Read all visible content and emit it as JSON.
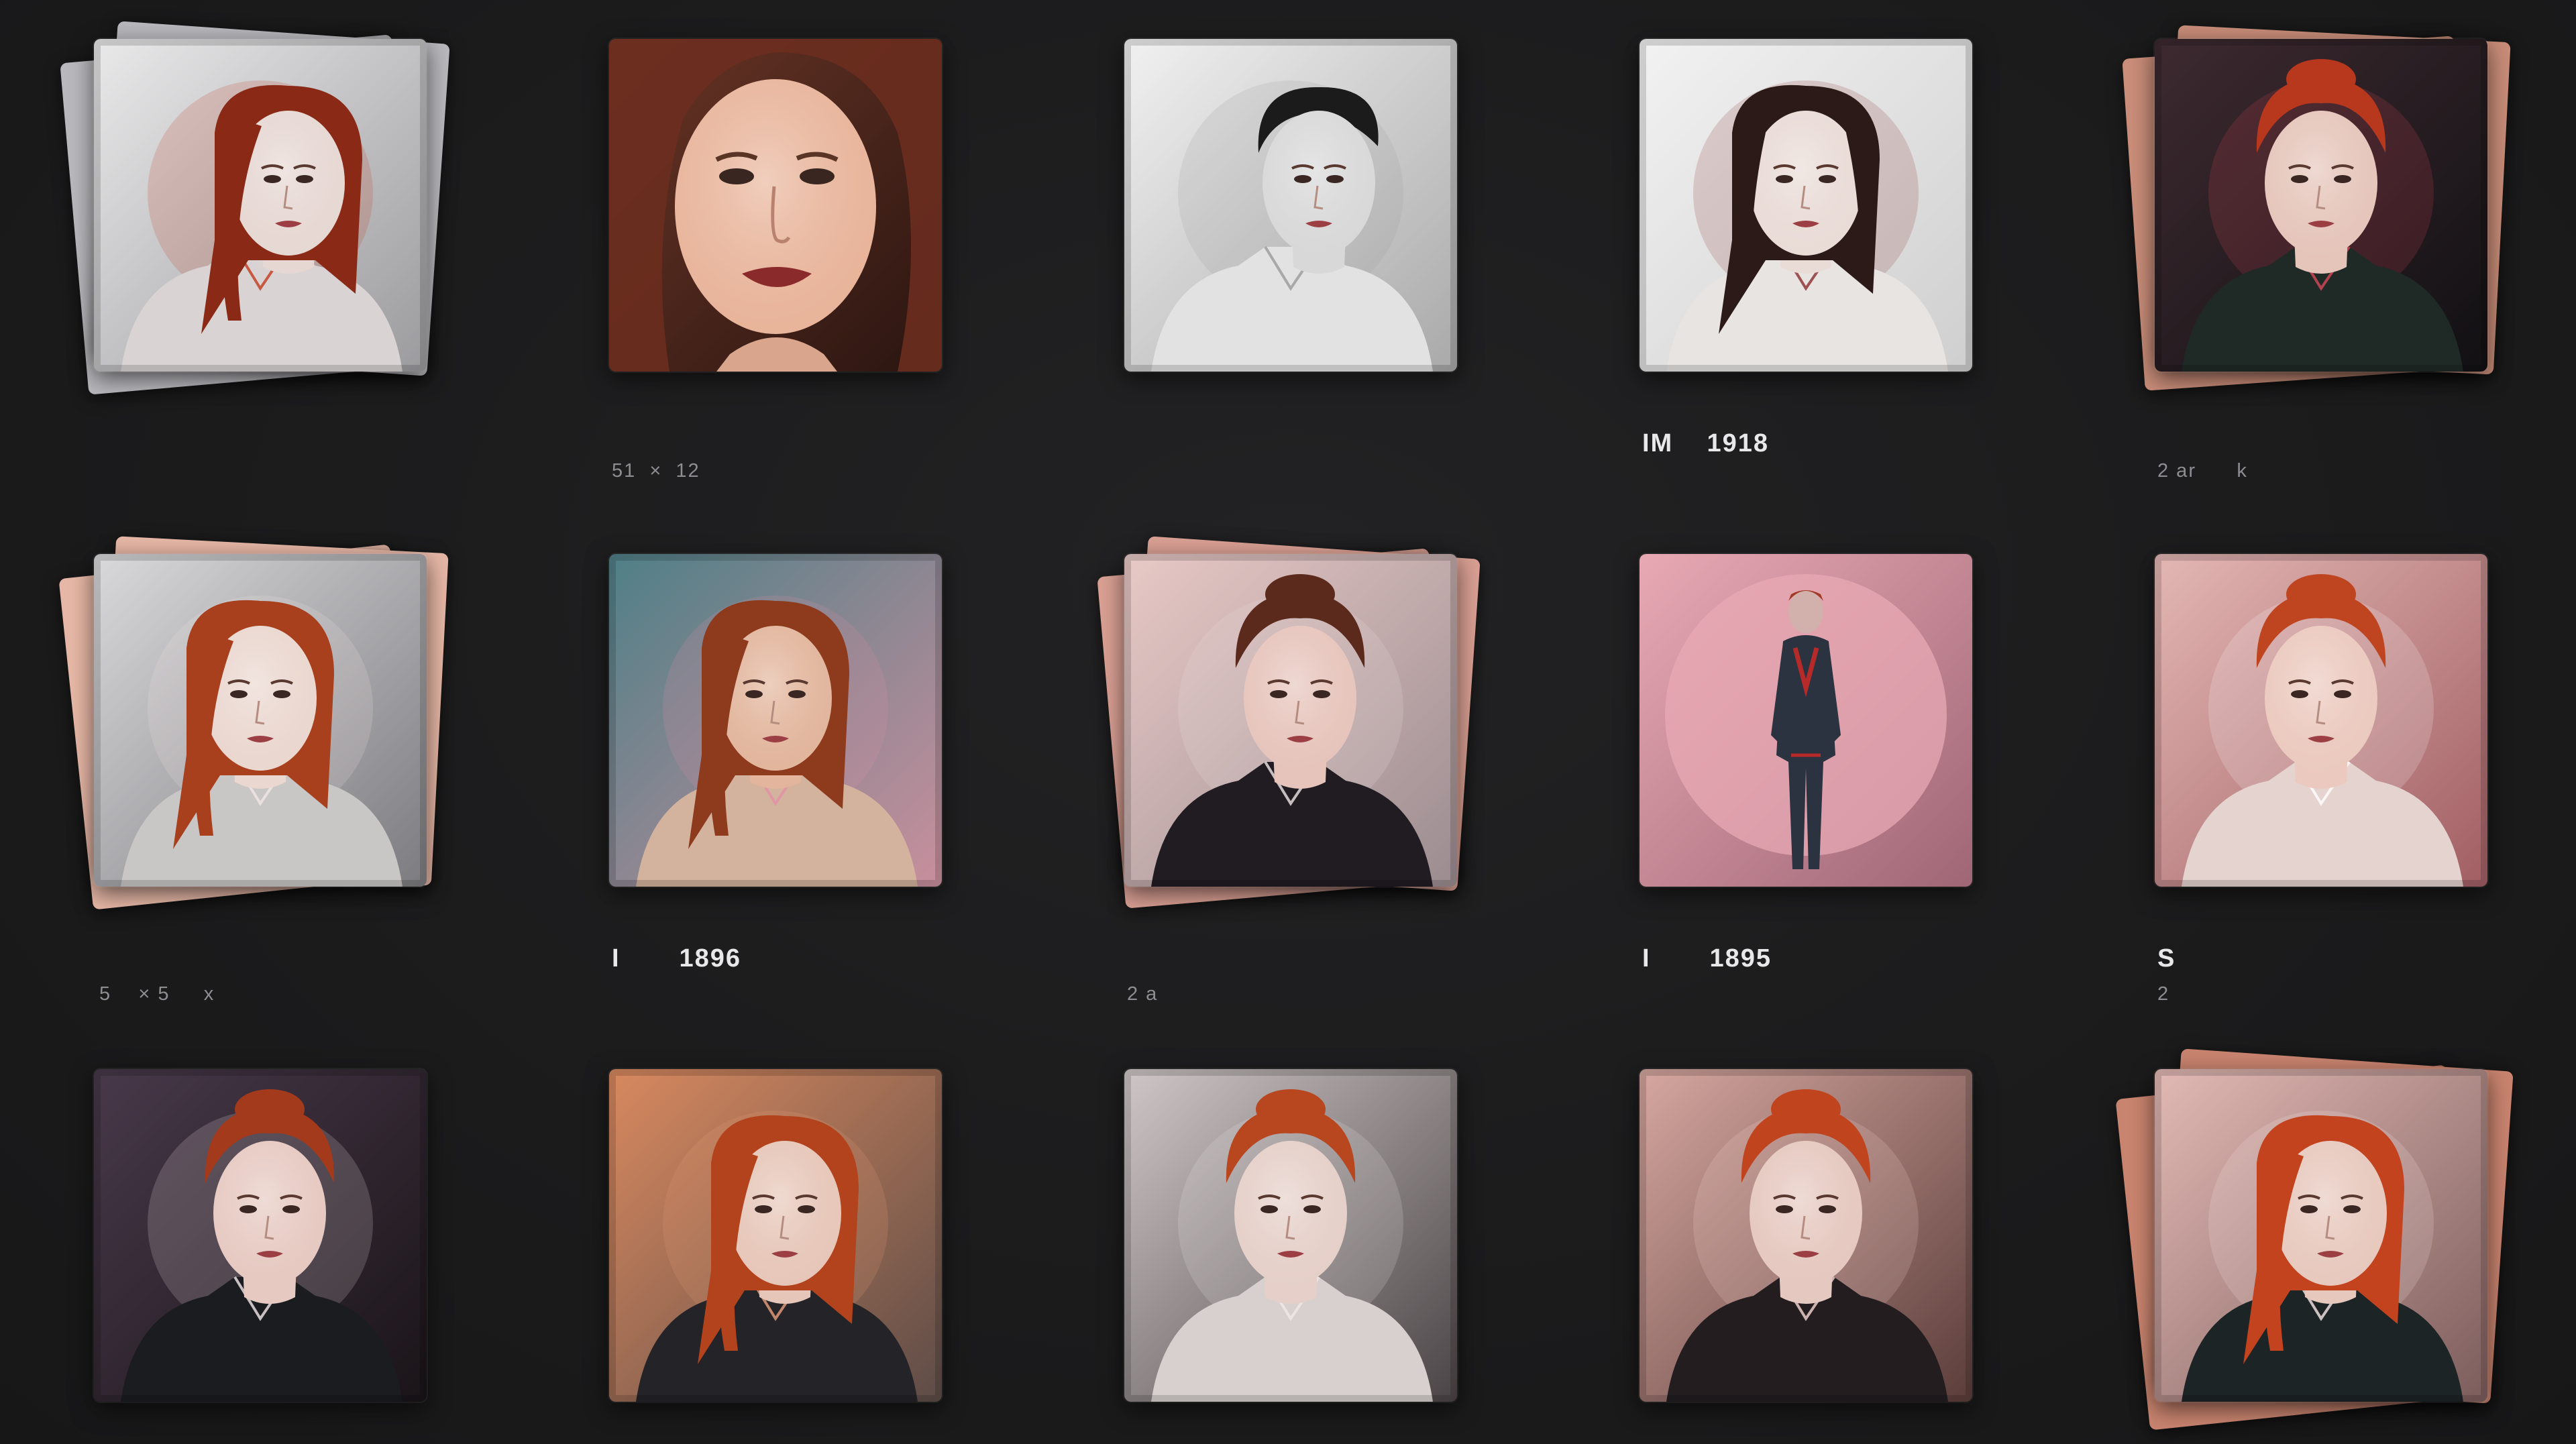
{
  "gallery": {
    "items": [
      {
        "title": "",
        "meta": "",
        "palette": {
          "bg1": "#e9e9ea",
          "bg2": "#9b9b9e",
          "skin": "#e6d7d2",
          "hair": "#8a2a16",
          "suit": "#d9d4d3",
          "accent": "#c23a1c"
        },
        "stacked": true,
        "stack_color": "#b9b9bd",
        "hair_style": "long-side",
        "pose": "profile"
      },
      {
        "title": "",
        "meta": "51  ×  12",
        "palette": {
          "bg1": "#6a3526",
          "bg2": "#2a1510",
          "skin": "#e8b49a",
          "hair": "#6c2e1f",
          "suit": "#d9a58c",
          "accent": "#8a2a2a"
        },
        "stacked": false,
        "stack_color": "",
        "hair_style": "long",
        "pose": "closeup"
      },
      {
        "title": "",
        "meta": "",
        "palette": {
          "bg1": "#f1f1f1",
          "bg2": "#a9a9a9",
          "skin": "#d8d8d8",
          "hair": "#1b1b1b",
          "suit": "#e2e2e2",
          "accent": "#9a9a9a"
        },
        "stacked": false,
        "stack_color": "",
        "hair_style": "short",
        "pose": "profile"
      },
      {
        "title": "IM    1918",
        "meta": "",
        "palette": {
          "bg1": "#f2f2f2",
          "bg2": "#cfcfcf",
          "skin": "#e9dbd6",
          "hair": "#2b1a17",
          "suit": "#e7e4e2",
          "accent": "#8b2d2d"
        },
        "stacked": false,
        "stack_color": "",
        "hair_style": "long",
        "pose": "front"
      },
      {
        "title": "",
        "meta": "2 ar      k",
        "palette": {
          "bg1": "#3d2a30",
          "bg2": "#111013",
          "skin": "#e5c5ba",
          "hair": "#b8381d",
          "suit": "#1f2a26",
          "accent": "#d8485a"
        },
        "stacked": true,
        "stack_color": "#c98d79",
        "hair_style": "up",
        "pose": "front"
      },
      {
        "title": "",
        "meta": "5    × 5     x",
        "palette": {
          "bg1": "#d9d9db",
          "bg2": "#7c7c80",
          "skin": "#ead7cf",
          "hair": "#a8401e",
          "suit": "#c9c6c6",
          "accent": "#f2e6e2"
        },
        "stacked": true,
        "stack_color": "#e6b7a6",
        "hair_style": "braid",
        "pose": "front"
      },
      {
        "title": "I       1896",
        "meta": "",
        "palette": {
          "bg1": "#4f7f87",
          "bg2": "#c98f9d",
          "skin": "#e2b59c",
          "hair": "#8d3a1d",
          "suit": "#d3b39d",
          "accent": "#e38fa7"
        },
        "stacked": false,
        "stack_color": "",
        "hair_style": "braid",
        "pose": "front"
      },
      {
        "title": "",
        "meta": "2 a",
        "palette": {
          "bg1": "#e8c9c6",
          "bg2": "#9b8c90",
          "skin": "#e6c4bb",
          "hair": "#5c2a1c",
          "suit": "#201c22",
          "accent": "#f0e6e6"
        },
        "stacked": true,
        "stack_color": "#d99f93",
        "hair_style": "up",
        "pose": "three-quarter"
      },
      {
        "title": "I       1895",
        "meta": "",
        "palette": {
          "bg1": "#e8a9b4",
          "bg2": "#9f6676",
          "skin": "#d2b0ab",
          "hair": "#a13a24",
          "suit": "#2c3340",
          "accent": "#b72a2a"
        },
        "stacked": false,
        "stack_color": "",
        "hair_style": "short",
        "pose": "full-body"
      },
      {
        "title": "S",
        "meta": "2",
        "palette": {
          "bg1": "#e3b7b4",
          "bg2": "#a15e63",
          "skin": "#ebc9be",
          "hair": "#bf4420",
          "suit": "#e4d3cf",
          "accent": "#ffffff"
        },
        "stacked": false,
        "stack_color": "",
        "hair_style": "up",
        "pose": "front"
      },
      {
        "title": "",
        "meta": "",
        "palette": {
          "bg1": "#48394a",
          "bg2": "#1a1418",
          "skin": "#e6c9c1",
          "hair": "#a33a1c",
          "suit": "#1a1c20",
          "accent": "#f3e9e9"
        },
        "stacked": false,
        "stack_color": "",
        "hair_style": "up",
        "pose": "three-quarter"
      },
      {
        "title": "",
        "meta": "",
        "palette": {
          "bg1": "#d8895f",
          "bg2": "#5d4c47",
          "skin": "#e6c6b8",
          "hair": "#b2431c",
          "suit": "#242327",
          "accent": "#eaa07c"
        },
        "stacked": false,
        "stack_color": "",
        "hair_style": "long-side",
        "pose": "three-quarter"
      },
      {
        "title": "",
        "meta": "",
        "palette": {
          "bg1": "#cfc7c7",
          "bg2": "#4b4446",
          "skin": "#e5cfc8",
          "hair": "#b8461f",
          "suit": "#d7d0cf",
          "accent": "#f1e9e7"
        },
        "stacked": false,
        "stack_color": "",
        "hair_style": "up",
        "pose": "front"
      },
      {
        "title": "",
        "meta": "",
        "palette": {
          "bg1": "#d6a7a0",
          "bg2": "#5b3d3a",
          "skin": "#e5c8bf",
          "hair": "#c0451e",
          "suit": "#231d20",
          "accent": "#f7d7d2"
        },
        "stacked": false,
        "stack_color": "",
        "hair_style": "up",
        "pose": "front"
      },
      {
        "title": "",
        "meta": "",
        "palette": {
          "bg1": "#e2b9b4",
          "bg2": "#7c5d5c",
          "skin": "#e7c8bd",
          "hair": "#c2431d",
          "suit": "#1d2426",
          "accent": "#f9e9e7"
        },
        "stacked": true,
        "stack_color": "#c9846f",
        "hair_style": "long-side",
        "pose": "three-quarter"
      }
    ]
  }
}
